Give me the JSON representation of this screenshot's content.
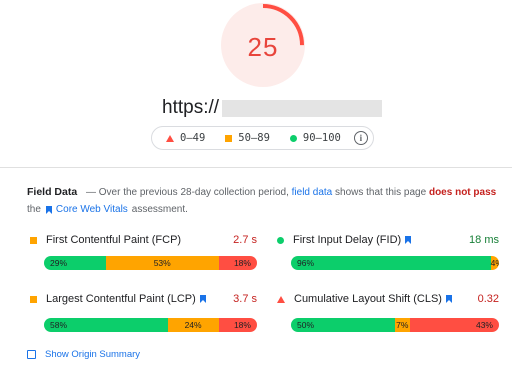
{
  "score": {
    "value": "25",
    "fraction": 0.25,
    "color": "#e8453c"
  },
  "url": {
    "prefix": "https://"
  },
  "legend": {
    "fail": "0–49",
    "average": "50–89",
    "pass": "90–100",
    "info_icon": "info-icon"
  },
  "field_data": {
    "title": "Field Data",
    "desc_part1": "— Over the previous 28-day collection period,",
    "desc_link": "field data",
    "desc_part2": "shows that this page",
    "desc_fail": "does not pass",
    "desc_part3": "the",
    "cwv_link": "Core Web Vitals",
    "desc_part4": "assessment."
  },
  "metrics": {
    "fcp": {
      "label": "First Contentful Paint (FCP)",
      "value": "2.7 s",
      "value_color": "#c5221f",
      "good": "29%",
      "avg": "53%",
      "poor": "18%",
      "good_frac": 0.29,
      "avg_frac": 0.53,
      "poor_frac": 0.18
    },
    "fid": {
      "label": "First Input Delay (FID)",
      "value": "18 ms",
      "value_color": "#188038",
      "good": "96%",
      "avg": "4%",
      "poor": "",
      "good_frac": 0.96,
      "avg_frac": 0.04,
      "poor_frac": 0.0
    },
    "lcp": {
      "label": "Largest Contentful Paint (LCP)",
      "value": "3.7 s",
      "value_color": "#c5221f",
      "good": "58%",
      "avg": "24%",
      "poor": "18%",
      "good_frac": 0.58,
      "avg_frac": 0.24,
      "poor_frac": 0.18
    },
    "cls": {
      "label": "Cumulative Layout Shift (CLS)",
      "value": "0.32",
      "value_color": "#c5221f",
      "good": "50%",
      "avg": "7%",
      "poor": "43%",
      "good_frac": 0.5,
      "avg_frac": 0.07,
      "poor_frac": 0.43
    }
  },
  "origin_summary": {
    "label": "Show Origin Summary"
  },
  "colors": {
    "good": "#0cce6b",
    "average": "#ffa400",
    "poor": "#ff4e42",
    "link": "#1a73e8"
  }
}
